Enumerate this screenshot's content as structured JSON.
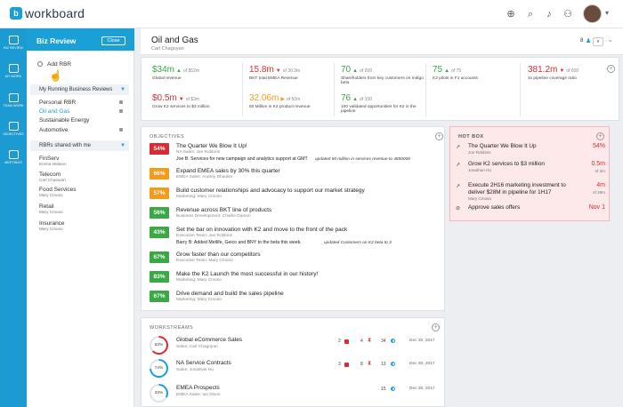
{
  "app": {
    "name": "workboard"
  },
  "nav": [
    {
      "label": "BIZ REVIEW"
    },
    {
      "label": "MY WORK"
    },
    {
      "label": "TEAM WORK"
    },
    {
      "label": "OBJECTIVES"
    },
    {
      "label": "MEETINGS"
    }
  ],
  "sidebar": {
    "title": "Biz Review",
    "close_label": "Close",
    "add_label": "Add RBR",
    "my_section": "My Running Business Reviews",
    "my_items": [
      {
        "label": "Personal RBR"
      },
      {
        "label": "Oil and Gas"
      },
      {
        "label": "Sustainable Energy"
      },
      {
        "label": "Automotive"
      }
    ],
    "shared_section": "RBRs shared with me",
    "shared_items": [
      {
        "label": "FinServ",
        "owner": "Emma Watson"
      },
      {
        "label": "Telecom",
        "owner": "Carl Chaiovan"
      },
      {
        "label": "Food Services",
        "owner": "Mary Cmoso"
      },
      {
        "label": "Retail",
        "owner": "Mary Cmoso"
      },
      {
        "label": "Insurance",
        "owner": "Mary Cmoso"
      }
    ]
  },
  "header": {
    "title": "Oil and Gas",
    "owner": "Carl Chagoyan",
    "share_count": "8"
  },
  "kpis": [
    {
      "value": "$34m",
      "of": "of $52m",
      "label": "Global revenue",
      "color": "#39a845"
    },
    {
      "value": "15.8m",
      "of": "of 30.3m",
      "label": "BKT total EMEA Revenue",
      "color": "#d82c32"
    },
    {
      "value": "70",
      "of": "of 200",
      "label": "Shareholders from key customers on Indigo beta",
      "color": "#39a845"
    },
    {
      "value": "75",
      "of": "of 75",
      "label": "K2 pilots in F1 accounts",
      "color": "#39a845"
    },
    {
      "value": "381.2m",
      "of": "of 600",
      "label": "4x pipeline coverage ratio",
      "color": "#d82c32"
    },
    {
      "value": "$0.5m",
      "of": "of $3m",
      "label": "Grow K2 services to $3 million",
      "color": "#d82c32"
    },
    {
      "value": "32.06m",
      "of": "of 50m",
      "label": "50 Million in K2 product revenue",
      "color": "#f49b1c"
    },
    {
      "value": "76",
      "of": "of 100",
      "label": "100 validated opportunities for K2 in the pipeline",
      "color": "#39a845"
    }
  ],
  "objectives": {
    "heading": "OBJECTIVES",
    "items": [
      {
        "pct": "54%",
        "color": "#d82c32",
        "title": "The Quarter We Blow It Up!",
        "owner": "NA Sales: Joe Robbins",
        "update_title": "Joe B: Services for new campaign and analytics support at GMT",
        "update_note": "updated 50 million in services revenue to 4850000"
      },
      {
        "pct": "66%",
        "color": "#f49b1c",
        "title": "Expand EMEA sales by 30% this quarter",
        "owner": "EMEA Sales: Audrey Dhaulier"
      },
      {
        "pct": "57%",
        "color": "#f49b1c",
        "title": "Build customer relationships and advocacy to support our market strategy",
        "owner": "Marketing: Mary Cmoso"
      },
      {
        "pct": "56%",
        "color": "#39a845",
        "title": "Revenue across BKT line of products",
        "owner": "Business Development: Charlie Damon"
      },
      {
        "pct": "43%",
        "color": "#39a845",
        "title": "Set the bar on innovation with K2 and move to the front of the pack",
        "owner": "Executive Team: Joe Robbins",
        "update_title": "Barry B: Added Metlife, Geico and BNY to the beta this week.",
        "update_note": "updated Customers on K2 beta to 3"
      },
      {
        "pct": "67%",
        "color": "#39a845",
        "title": "Grow faster than our competitors",
        "owner": "Executive Team: Mary Cmoso"
      },
      {
        "pct": "83%",
        "color": "#39a845",
        "title": "Make the K2 Launch the most successful in our history!",
        "owner": "Marketing: Mary Cmoso"
      },
      {
        "pct": "67%",
        "color": "#39a845",
        "title": "Drive demand and build the sales pipeline",
        "owner": "Marketing: Mary Cmoso"
      }
    ]
  },
  "hotbox": {
    "heading": "HOT BOX",
    "items": [
      {
        "title": "The Quarter We Blow It Up",
        "owner": "Joe Robbins",
        "value": "54%",
        "sub": ""
      },
      {
        "title": "Grow K2 services to $3 million",
        "owner": "Jonathan Hu",
        "value": "0.5m",
        "sub": "of 3m"
      },
      {
        "title": "Execute 2H16 marketing investment to deliver $28M in pipeline for 1H17",
        "owner": "Mary Cmoso",
        "value": "4m",
        "sub": "of 28m"
      },
      {
        "title": "Approve sales offers",
        "owner": "",
        "value": "Nov 1",
        "sub": ""
      }
    ]
  },
  "workstreams": {
    "heading": "WORKSTREAMS",
    "items": [
      {
        "pct": "63%",
        "pct_num": 63,
        "ring": "#d82c32",
        "title": "Global eCommerce Sales",
        "owner": "Sales: Carl Chagoyan",
        "a": "2",
        "b": "4",
        "c": "34",
        "date": "Dec 30, 2017"
      },
      {
        "pct": "74%",
        "pct_num": 74,
        "ring": "#1a9fd6",
        "title": "NA Service Contracts",
        "owner": "Sales: Jonathan Hu",
        "a": "3",
        "b": "8",
        "c": "13",
        "date": "Dec 30, 2017"
      },
      {
        "pct": "33%",
        "pct_num": 33,
        "ring": "#1a9fd6",
        "title": "EMEA Prospects",
        "owner": "EMEA Sales: Ian Dixon",
        "a": "",
        "b": "",
        "c": "15",
        "date": "Dec 30, 2017"
      }
    ]
  }
}
